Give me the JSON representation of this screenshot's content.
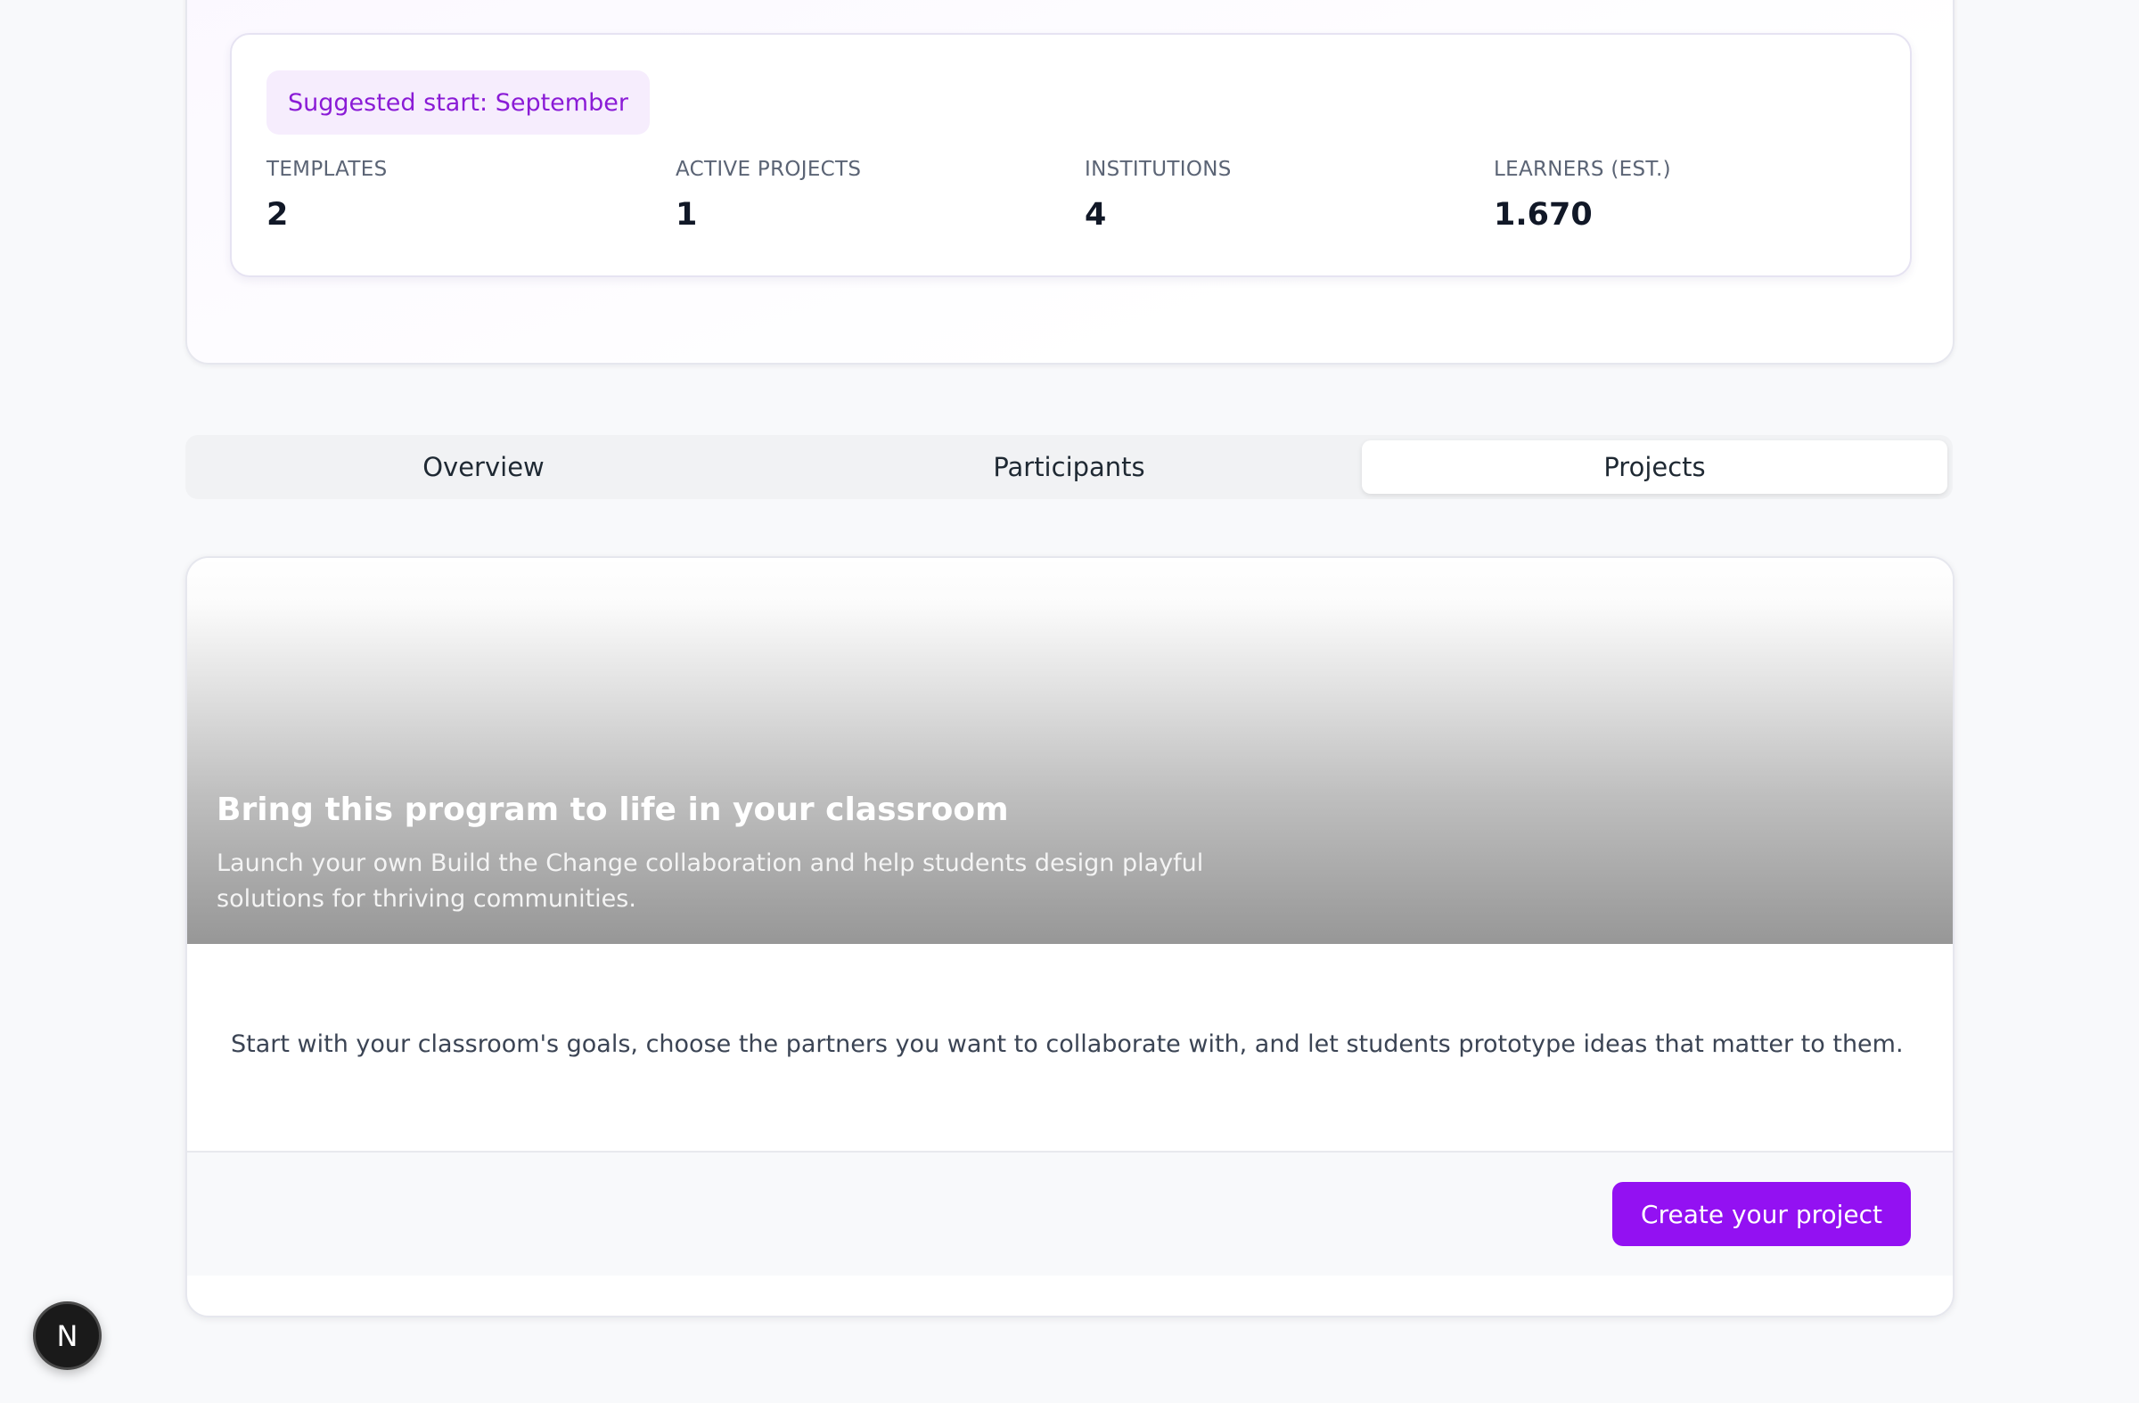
{
  "program": {
    "start_badge": "Suggested start: September",
    "stats": [
      {
        "label": "TEMPLATES",
        "value": "2"
      },
      {
        "label": "ACTIVE PROJECTS",
        "value": "1"
      },
      {
        "label": "INSTITUTIONS",
        "value": "4"
      },
      {
        "label": "LEARNERS (EST.)",
        "value": "1.670"
      }
    ]
  },
  "tabs": [
    {
      "label": "Overview",
      "active": false
    },
    {
      "label": "Participants",
      "active": false
    },
    {
      "label": "Projects",
      "active": true
    }
  ],
  "cta": {
    "title": "Bring this program to life in your classroom",
    "subtitle": "Launch your own Build the Change collaboration and help students design playful solutions for thriving communities.",
    "body": "Start with your classroom's goals, choose the partners you want to collaborate with, and let students prototype ideas that matter to them.",
    "button_label": "Create your project"
  },
  "floating_badge": {
    "letter": "N",
    "icon": "n-logo-icon"
  },
  "colors": {
    "accent": "#9311f2",
    "badge_text": "#8a1bd6",
    "badge_bg": "#f6edfd"
  }
}
